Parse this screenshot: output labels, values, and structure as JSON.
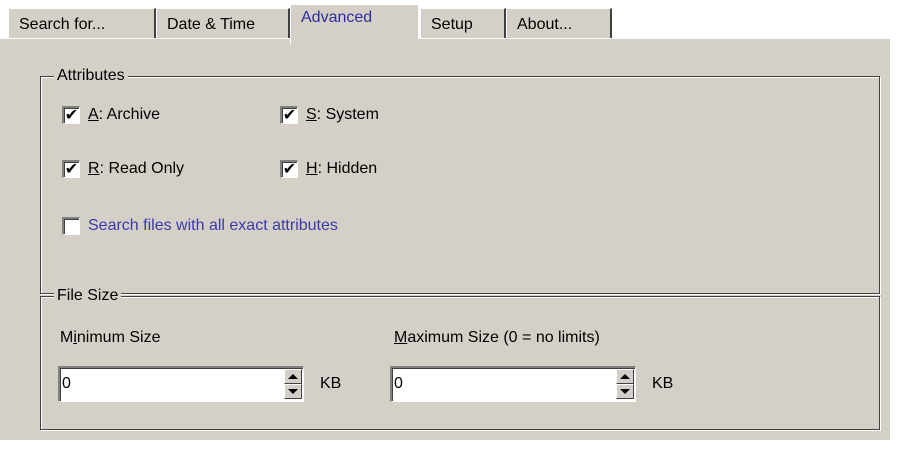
{
  "tabs": [
    {
      "label": "Search for...",
      "active": false
    },
    {
      "label": "Date & Time",
      "active": false
    },
    {
      "label": "Advanced",
      "active": true
    },
    {
      "label": "Setup",
      "active": false
    },
    {
      "label": "About...",
      "active": false
    }
  ],
  "attributes": {
    "legend": "Attributes",
    "archive": {
      "key": "A",
      "rest": ": Archive",
      "checked": true
    },
    "system": {
      "key": "S",
      "rest": ": System",
      "checked": true
    },
    "readonly": {
      "key": "R",
      "rest": ": Read Only",
      "checked": true
    },
    "hidden": {
      "key": "H",
      "rest": ": Hidden",
      "checked": true
    },
    "exact": {
      "label": "Search files with all exact attributes",
      "checked": false
    }
  },
  "file_size": {
    "legend": "File Size",
    "min": {
      "label_pre": "M",
      "label_key": "i",
      "label_post": "nimum Size",
      "value": "0",
      "unit": "KB"
    },
    "max": {
      "label_key": "M",
      "label_post": "aximum Size  (0 = no limits)",
      "value": "0",
      "unit": "KB"
    }
  },
  "colors": {
    "panel": "#d4d0c8",
    "accent_text": "#3a3aa8"
  }
}
